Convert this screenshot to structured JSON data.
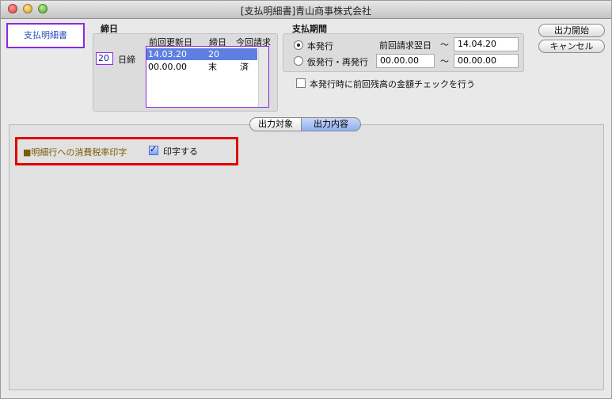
{
  "window": {
    "title": "[支払明細書]青山商事株式会社"
  },
  "doc_badge": "支払明細書",
  "closing": {
    "section_label": "締日",
    "value": "20",
    "unit": "日締",
    "headers": [
      "前回更新日",
      "締日",
      "今回請求"
    ],
    "rows": [
      {
        "date": "14.03.20",
        "day": "20",
        "status": "",
        "selected": true
      },
      {
        "date": "00.00.00",
        "day": "末",
        "status": "済",
        "selected": false
      }
    ]
  },
  "payment_period": {
    "section_label": "支払期間",
    "options": [
      {
        "label": "本発行",
        "checked": true
      },
      {
        "label": "仮発行・再発行",
        "checked": false
      }
    ],
    "from_label": "前回請求翌日",
    "from_value_reissue": "00.00.00",
    "tilde": "〜",
    "to_value": "14.04.20",
    "to_value_reissue": "00.00.00"
  },
  "check_prev_balance": {
    "label": "本発行時に前回残高の金額チェックを行う",
    "checked": false
  },
  "buttons": {
    "start": "出力開始",
    "cancel": "キャンセル"
  },
  "tabs": [
    {
      "label": "出力対象",
      "active": false
    },
    {
      "label": "出力内容",
      "active": true
    }
  ],
  "options": {
    "tax_print_label": "■明細行への消費税率印字",
    "print_checkbox": {
      "label": "印字する",
      "checked": true
    }
  }
}
